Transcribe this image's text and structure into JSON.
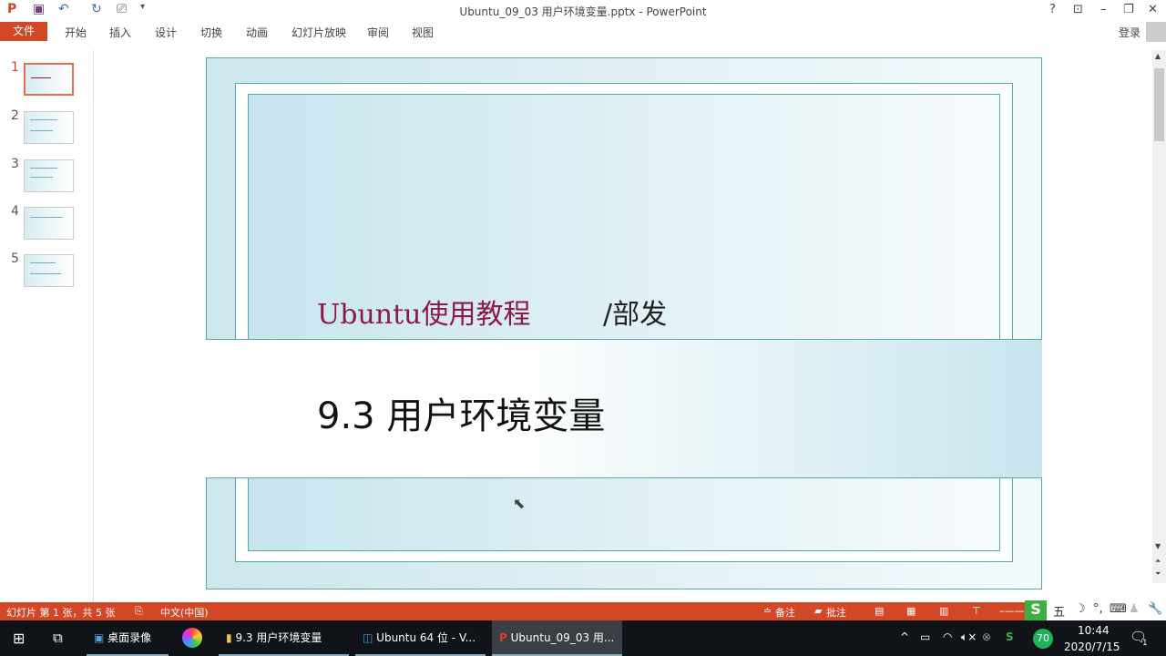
{
  "window": {
    "title": "Ubuntu_09_03 用户环境变量.pptx - PowerPoint",
    "sign_in": "登录",
    "help": "?"
  },
  "ribbon": {
    "file": "文件",
    "tabs": [
      "开始",
      "插入",
      "设计",
      "切换",
      "动画",
      "幻灯片放映",
      "审阅",
      "视图"
    ]
  },
  "thumbnails": [
    "1",
    "2",
    "3",
    "4",
    "5"
  ],
  "slide": {
    "subtitle": "Ubuntu使用教程",
    "author": "/部发",
    "title": "9.3 用户环境变量"
  },
  "status": {
    "slide_info": "幻灯片 第 1 张，共 5 张",
    "language": "中文(中国)",
    "notes": "备注",
    "comments": "批注"
  },
  "ime": {
    "mode": "五"
  },
  "taskbar": {
    "items": [
      "桌面录像",
      "9.3 用户环境变量",
      "Ubuntu 64 位 - V...",
      "Ubuntu_09_03 用..."
    ],
    "time": "10:44",
    "date": "2020/7/15",
    "badge": "70",
    "notification_count": "1"
  },
  "colors": {
    "accent": "#d24726",
    "subtitle": "#8b1a4a"
  }
}
